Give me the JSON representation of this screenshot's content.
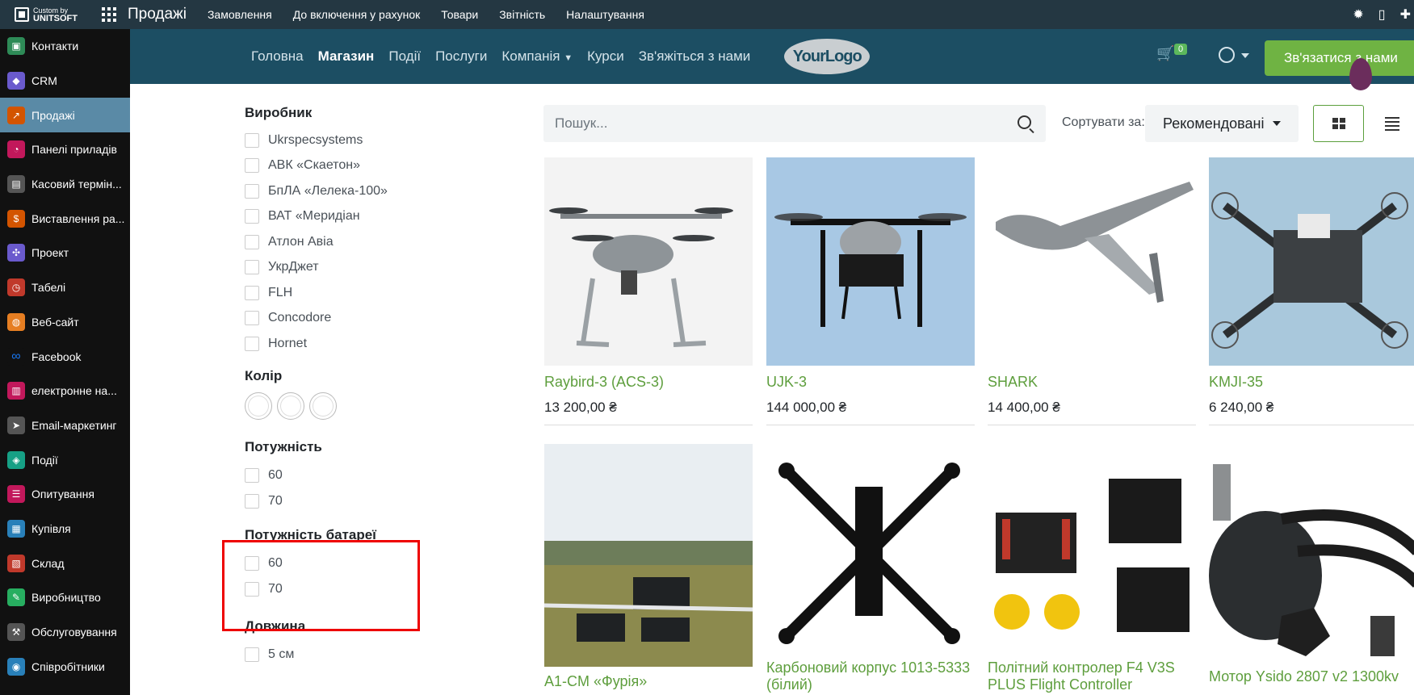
{
  "topbar": {
    "brand_small": "Custom by",
    "brand_large": "UNITSOFT",
    "app_title": "Продажі",
    "menu": [
      "Замовлення",
      "До включення у рахунок",
      "Товари",
      "Звітність",
      "Налаштування"
    ]
  },
  "sidebar": {
    "items": [
      {
        "label": "Контакти",
        "color": "#2e8b57",
        "icon": "contacts-icon"
      },
      {
        "label": "CRM",
        "color": "#6a5acd",
        "icon": "handshake-icon"
      },
      {
        "label": "Продажі",
        "color": "#d35400",
        "icon": "chart-icon",
        "active": true
      },
      {
        "label": "Панелі приладів",
        "color": "#c2185b",
        "icon": "dashboard-icon"
      },
      {
        "label": "Касовий термін...",
        "color": "#555555",
        "icon": "store-icon"
      },
      {
        "label": "Виставлення ра...",
        "color": "#d35400",
        "icon": "invoice-icon"
      },
      {
        "label": "Проект",
        "color": "#6a5acd",
        "icon": "puzzle-icon"
      },
      {
        "label": "Табелі",
        "color": "#c0392b",
        "icon": "timer-icon"
      },
      {
        "label": "Веб-сайт",
        "color": "#e67e22",
        "icon": "globe-icon"
      },
      {
        "label": "Facebook",
        "color": "#111111",
        "icon": "meta-icon"
      },
      {
        "label": "електронне на...",
        "color": "#c2185b",
        "icon": "elearning-icon"
      },
      {
        "label": "Email-маркетинг",
        "color": "#555555",
        "icon": "paper-plane-icon"
      },
      {
        "label": "Події",
        "color": "#16a085",
        "icon": "ticket-icon"
      },
      {
        "label": "Опитування",
        "color": "#c2185b",
        "icon": "survey-icon"
      },
      {
        "label": "Купівля",
        "color": "#2980b9",
        "icon": "purchase-icon"
      },
      {
        "label": "Склад",
        "color": "#c0392b",
        "icon": "warehouse-icon"
      },
      {
        "label": "Виробництво",
        "color": "#27ae60",
        "icon": "wrench-icon"
      },
      {
        "label": "Обслуговування",
        "color": "#555555",
        "icon": "hammer-icon"
      },
      {
        "label": "Співробітники",
        "color": "#2980b9",
        "icon": "users-icon"
      }
    ]
  },
  "site": {
    "nav": [
      "Головна",
      "Магазин",
      "Події",
      "Послуги",
      "Компанія",
      "Курси",
      "Зв'яжіться з нами"
    ],
    "logo_text": "YourLogo",
    "cart_count": "0",
    "contact_button": "Зв'язатися з нами"
  },
  "filters": {
    "manufacturer": {
      "title": "Виробник",
      "options": [
        "Ukrspecsystems",
        "АВК «Скаетон»",
        "БпЛА «Лелека-100»",
        "ВАТ «Меридіан",
        "Атлон Авіа",
        "УкрДжет",
        "FLH",
        "Concodore",
        "Hornet"
      ]
    },
    "color": {
      "title": "Колір"
    },
    "power": {
      "title": "Потужність",
      "options": [
        "60",
        "70"
      ]
    },
    "battery": {
      "title": "Потужність батареї",
      "options": [
        "60",
        "70"
      ]
    },
    "length": {
      "title": "Довжина",
      "options": [
        "5 см"
      ]
    }
  },
  "toolbar": {
    "search_placeholder": "Пошук...",
    "sort_label": "Сортувати за:",
    "sort_value": "Рекомендовані"
  },
  "products": [
    {
      "name": "Raybird-3 (ACS-3)",
      "price": "13 200,00 ₴"
    },
    {
      "name": "UJK-3",
      "price": "144 000,00 ₴"
    },
    {
      "name": "SHARK",
      "price": "14 400,00 ₴"
    },
    {
      "name": "KMJI-35",
      "price": "6 240,00 ₴"
    },
    {
      "name": "A1-CM «Фурія»",
      "price": ""
    },
    {
      "name": "Карбоновий корпус 1013-5333 (білий)",
      "price": ""
    },
    {
      "name": "Політний контролер F4 V3S PLUS Flight Controller",
      "price": ""
    },
    {
      "name": "Мотор Ysido 2807 v2 1300kv",
      "price": ""
    }
  ]
}
